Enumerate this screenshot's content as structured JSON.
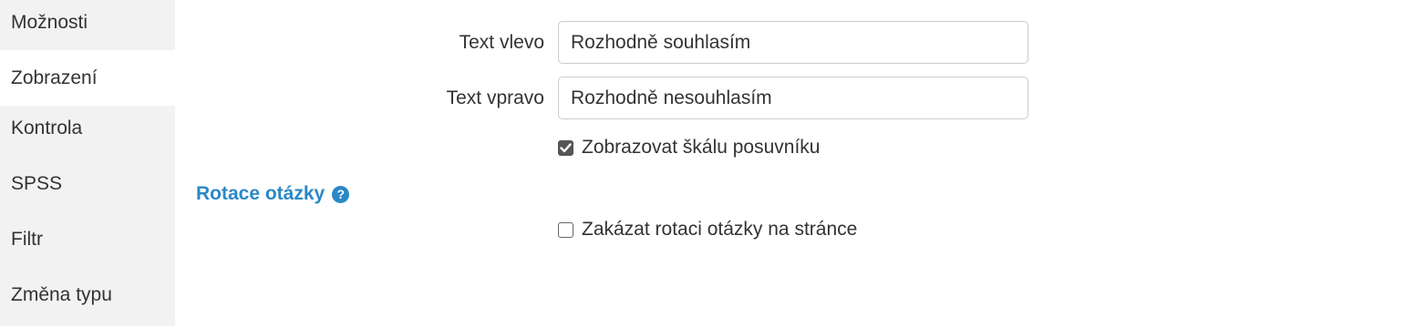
{
  "sidebar": {
    "items": [
      {
        "label": "Možnosti"
      },
      {
        "label": "Zobrazení"
      },
      {
        "label": "Kontrola"
      },
      {
        "label": "SPSS"
      },
      {
        "label": "Filtr"
      },
      {
        "label": "Změna typu"
      }
    ],
    "active_index": 1
  },
  "form": {
    "left_text": {
      "label": "Text vlevo",
      "value": "Rozhodně souhlasím"
    },
    "right_text": {
      "label": "Text vpravo",
      "value": "Rozhodně nesouhlasím"
    },
    "show_slider_scale": {
      "label": "Zobrazovat škálu posuvníku",
      "checked": true
    }
  },
  "rotation": {
    "title": "Rotace otázky",
    "help_icon": "question-circle-icon",
    "disable_rotation": {
      "label": "Zakázat rotaci otázky na stránce",
      "checked": false
    }
  },
  "colors": {
    "accent": "#2a88c6",
    "sidebar_bg": "#f2f2f2"
  }
}
